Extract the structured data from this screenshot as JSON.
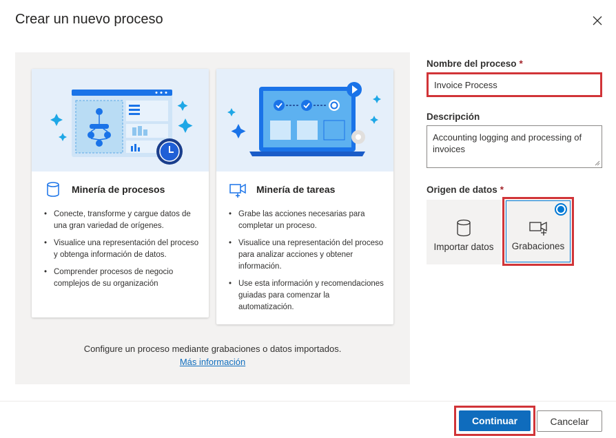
{
  "dialog": {
    "title": "Crear un nuevo proceso",
    "close_icon": "close-icon"
  },
  "cards": [
    {
      "title": "Minería de procesos",
      "icon": "database-icon",
      "bullets": [
        "Conecte, transforme y cargue datos de una gran variedad de orígenes.",
        "Visualice una representación del proceso y obtenga información de datos.",
        "Comprender procesos de negocio complejos de su organización"
      ]
    },
    {
      "title": "Minería de tareas",
      "icon": "video-add-icon",
      "bullets": [
        "Grabe las acciones necesarias para completar un proceso.",
        "Visualice una representación del proceso para analizar acciones y obtener información.",
        "Use esta información y recomendaciones guiadas para comenzar la automatización."
      ]
    }
  ],
  "panel": {
    "footer_text": "Configure un proceso mediante grabaciones o datos importados.",
    "learn_more": "Más información"
  },
  "form": {
    "name_label": "Nombre del proceso",
    "name_value": "Invoice Process",
    "required_mark": "*",
    "description_label": "Descripción",
    "description_value": "Accounting logging and processing of invoices",
    "source_label": "Origen de datos",
    "sources": [
      {
        "label": "Importar datos",
        "icon": "database-icon",
        "selected": false
      },
      {
        "label": "Grabaciones",
        "icon": "video-add-icon",
        "selected": true
      }
    ]
  },
  "footer": {
    "continue_label": "Continuar",
    "cancel_label": "Cancelar"
  },
  "colors": {
    "accent": "#0f6cbd",
    "highlight": "#d13438",
    "illustration_bg": "#e5effa"
  }
}
